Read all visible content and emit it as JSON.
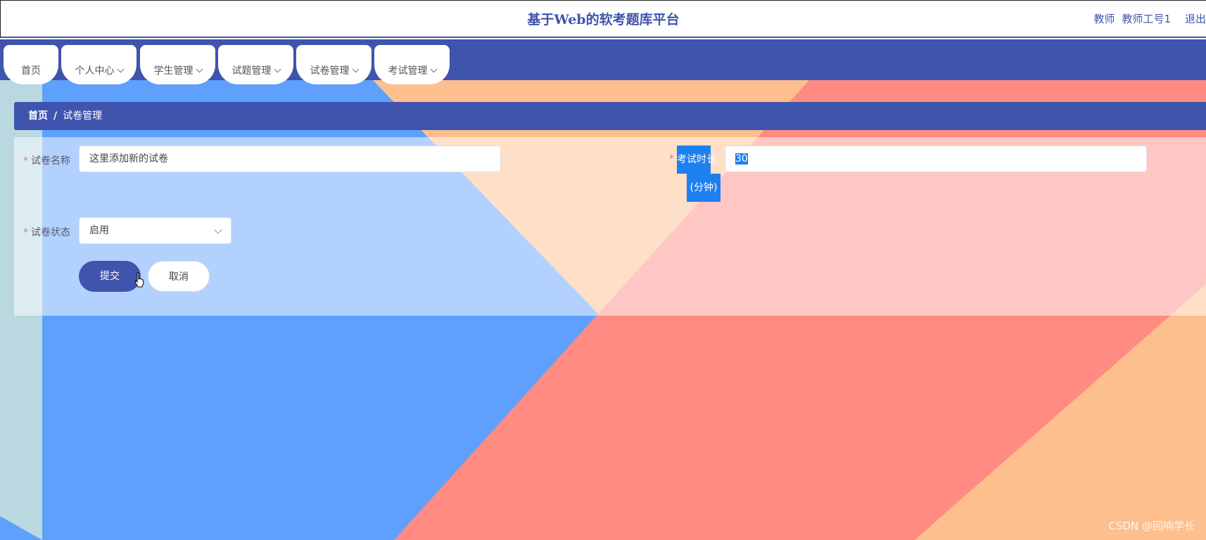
{
  "header": {
    "title": "基于Web的软考题库平台",
    "role": "教师",
    "username": "教师工号1",
    "logout": "退出"
  },
  "nav": {
    "items": [
      {
        "label": "首页",
        "has_dropdown": false
      },
      {
        "label": "个人中心",
        "has_dropdown": true
      },
      {
        "label": "学生管理",
        "has_dropdown": true
      },
      {
        "label": "试题管理",
        "has_dropdown": true
      },
      {
        "label": "试卷管理",
        "has_dropdown": true
      },
      {
        "label": "考试管理",
        "has_dropdown": true
      }
    ]
  },
  "breadcrumb": {
    "home": "首页",
    "separator": "/",
    "current": "试卷管理"
  },
  "form": {
    "name_label": "试卷名称",
    "name_value": "这里添加新的试卷",
    "duration_label_line1": "考试时长",
    "duration_label_line2": "(分钟)",
    "duration_value": "30",
    "status_label": "试卷状态",
    "status_value": "启用",
    "required_mark": "*",
    "submit": "提交",
    "cancel": "取消"
  },
  "watermark": "CSDN @回响学长",
  "colors": {
    "primary": "#3f54ad",
    "selection": "#1e7ff0",
    "required": "#f56c6c"
  }
}
